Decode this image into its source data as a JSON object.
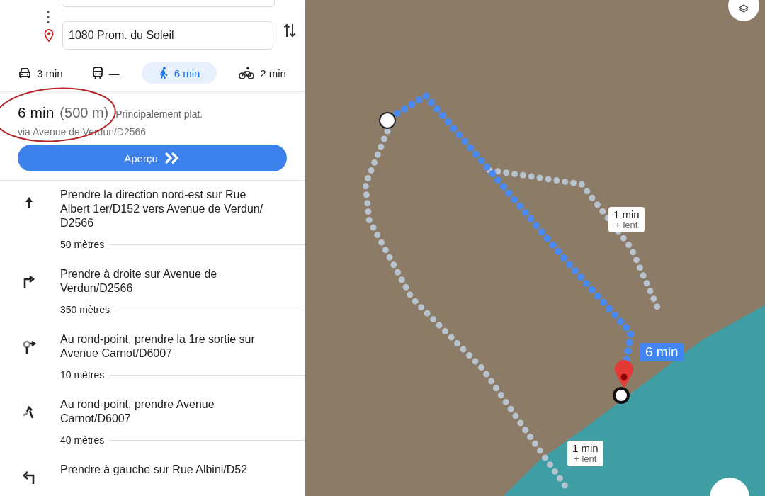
{
  "destination": {
    "value": "1080 Prom. du Soleil"
  },
  "modes": [
    {
      "kind": "car",
      "label": "3 min",
      "selected": false
    },
    {
      "kind": "transit",
      "label": "—",
      "selected": false
    },
    {
      "kind": "walk",
      "label": "6 min",
      "selected": true
    },
    {
      "kind": "bike",
      "label": "2 min",
      "selected": false
    }
  ],
  "summary": {
    "duration": "6 min",
    "distance": "(500 m)",
    "note": "Principalement plat.",
    "via": "via Avenue de Verdun/D2566"
  },
  "preview_button": {
    "label": "Aperçu"
  },
  "steps": [
    {
      "kind": "straight",
      "text": "Prendre la direction nord-est sur Rue Albert 1er/D152 vers Avenue de Verdun/ D2566",
      "distance": "50 mètres"
    },
    {
      "kind": "right",
      "text": "Prendre à droite sur Avenue de Verdun/D2566",
      "distance": "350 mètres"
    },
    {
      "kind": "roundabout-right",
      "text": "Au rond-point, prendre la 1re sortie sur Avenue Carnot/D6007",
      "distance": "10 mètres"
    },
    {
      "kind": "roundabout-straight",
      "text": "Au rond-point, prendre Avenue Carnot/D6007",
      "distance": "40 mètres"
    },
    {
      "kind": "left",
      "text": "Prendre à gauche sur Rue Albini/D52"
    }
  ],
  "map": {
    "route_badge": "6 min",
    "callouts": [
      {
        "time": "1 min",
        "note": "+ lent"
      },
      {
        "time": "1 min",
        "note": "+ lent"
      }
    ]
  }
}
